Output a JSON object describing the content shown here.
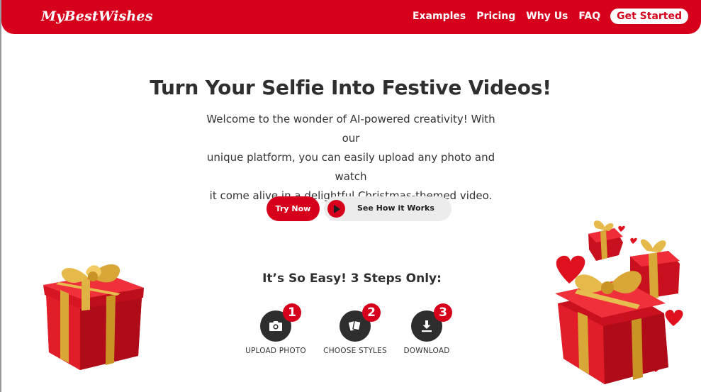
{
  "brand": {
    "logo_text": "MyBestWishes",
    "primary_color": "#d6001c",
    "dark_color": "#2e2e2e"
  },
  "nav": {
    "items": [
      {
        "label": "Examples"
      },
      {
        "label": "Pricing"
      },
      {
        "label": "Why Us"
      },
      {
        "label": "FAQ"
      }
    ],
    "cta_label": "Get Started"
  },
  "hero": {
    "title": "Turn Your Selfie Into Festive Videos!",
    "description_lines": [
      "Welcome to the wonder of AI-powered creativity! With our",
      "unique platform, you can easily upload any photo and watch",
      "it come alive in a delightful Christmas-themed video."
    ],
    "try_button_label": "Try Now",
    "how_button_label": "See How it Works",
    "how_button_icon": "play-icon"
  },
  "steps": {
    "title": "It’s So Easy! 3 Steps Only:",
    "items": [
      {
        "number": "1",
        "label": "UPLOAD PHOTO",
        "icon": "camera-icon"
      },
      {
        "number": "2",
        "label": "CHOOSE STYLES",
        "icon": "styles-icon"
      },
      {
        "number": "3",
        "label": "DOWNLOAD",
        "icon": "download-icon"
      }
    ]
  },
  "decorations": {
    "left": "gift-box",
    "right": "gift-boxes-with-hearts"
  }
}
